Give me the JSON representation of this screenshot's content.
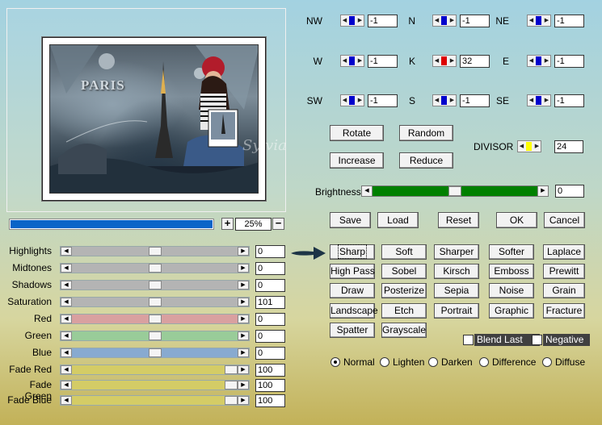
{
  "preview": {
    "photo_text": "PARIS",
    "watermark": "Sylvia"
  },
  "zoom": {
    "progress": 1.0,
    "plus": "+",
    "minus": "−",
    "value": "25%"
  },
  "directions": [
    {
      "label": "NW",
      "value": "-1",
      "thumb": "#0000cc"
    },
    {
      "label": "N",
      "value": "-1",
      "thumb": "#0000cc"
    },
    {
      "label": "NE",
      "value": "-1",
      "thumb": "#0000cc"
    },
    {
      "label": "W",
      "value": "-1",
      "thumb": "#0000cc"
    },
    {
      "label": "K",
      "value": "32",
      "thumb": "#dd0000"
    },
    {
      "label": "E",
      "value": "-1",
      "thumb": "#0000cc"
    },
    {
      "label": "SW",
      "value": "-1",
      "thumb": "#0000cc"
    },
    {
      "label": "S",
      "value": "-1",
      "thumb": "#0000cc"
    },
    {
      "label": "SE",
      "value": "-1",
      "thumb": "#0000cc"
    }
  ],
  "ops": {
    "rotate": "Rotate",
    "random": "Random",
    "increase": "Increase",
    "reduce": "Reduce"
  },
  "divisor": {
    "label": "DIVISOR",
    "value": "24",
    "thumb": "#ffff00"
  },
  "brightness": {
    "label": "Brightness",
    "value": "0",
    "level": 0.5,
    "track": "#008000"
  },
  "actions": {
    "save": "Save",
    "load": "Load",
    "reset": "Reset",
    "ok": "OK",
    "cancel": "Cancel"
  },
  "sliders": [
    {
      "label": "Highlights",
      "value": "0",
      "level": 0.5,
      "color": "#b4b4b4"
    },
    {
      "label": "Midtones",
      "value": "0",
      "level": 0.5,
      "color": "#b4b4b4"
    },
    {
      "label": "Shadows",
      "value": "0",
      "level": 0.5,
      "color": "#b4b4b4"
    },
    {
      "label": "Saturation",
      "value": "101",
      "level": 0.5,
      "color": "#b4b4b4"
    },
    {
      "label": "Red",
      "value": "0",
      "level": 0.5,
      "color": "#d9a0a0"
    },
    {
      "label": "Green",
      "value": "0",
      "level": 0.5,
      "color": "#99cc99"
    },
    {
      "label": "Blue",
      "value": "0",
      "level": 0.5,
      "color": "#88aad0"
    },
    {
      "label": "Fade Red",
      "value": "100",
      "level": 1.0,
      "color": "#d4cc66"
    },
    {
      "label": "Fade Green",
      "value": "100",
      "level": 1.0,
      "color": "#d4cc66"
    },
    {
      "label": "Fade Blue",
      "value": "100",
      "level": 1.0,
      "color": "#d4cc66"
    }
  ],
  "presets": [
    [
      "Sharp",
      "Soft",
      "Sharper",
      "Softer",
      "Laplace"
    ],
    [
      "High Pass",
      "Sobel",
      "Kirsch",
      "Emboss",
      "Prewitt"
    ],
    [
      "Draw",
      "Posterize",
      "Sepia",
      "Noise",
      "Grain"
    ],
    [
      "Landscape",
      "Etch",
      "Portrait",
      "Graphic",
      "Fracture"
    ],
    [
      "Spatter",
      "Grayscale"
    ]
  ],
  "checks": [
    {
      "label": "Blend Last",
      "checked": false
    },
    {
      "label": "Negative",
      "checked": false
    }
  ],
  "modes": [
    {
      "label": "Normal",
      "selected": true
    },
    {
      "label": "Lighten",
      "selected": false
    },
    {
      "label": "Darken",
      "selected": false
    },
    {
      "label": "Difference",
      "selected": false
    },
    {
      "label": "Diffuse",
      "selected": false
    }
  ]
}
